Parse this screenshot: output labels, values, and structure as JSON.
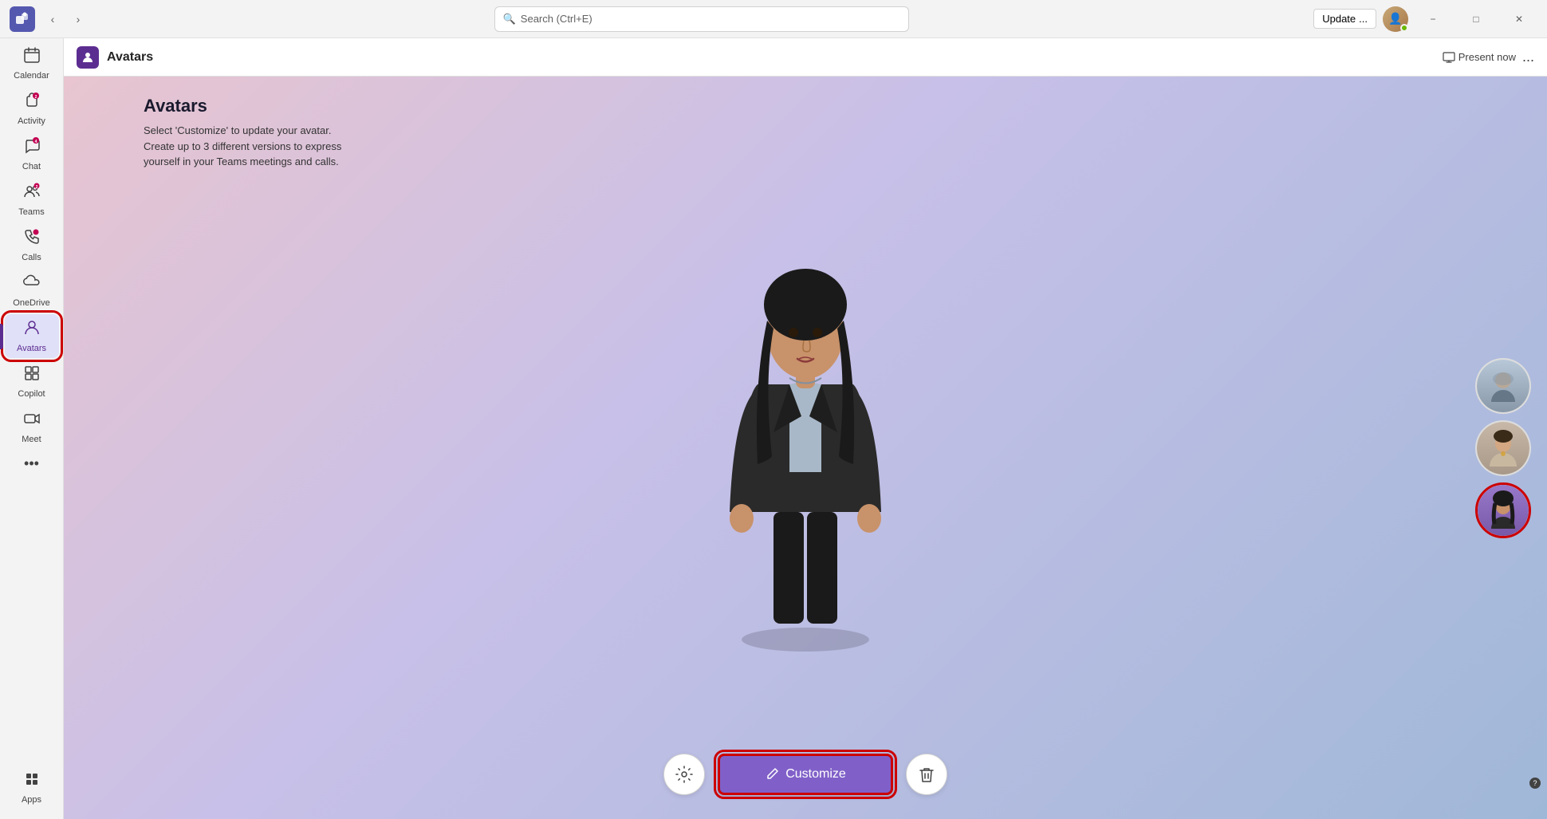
{
  "titleBar": {
    "searchPlaceholder": "Search (Ctrl+E)",
    "updateLabel": "Update",
    "moreLabel": "...",
    "minimizeLabel": "−",
    "maximizeLabel": "□",
    "closeLabel": "✕"
  },
  "sidebar": {
    "items": [
      {
        "id": "calendar",
        "label": "Calendar",
        "icon": "📅",
        "badge": null
      },
      {
        "id": "activity",
        "label": "Activity",
        "icon": "🔔",
        "badge": "2"
      },
      {
        "id": "chat",
        "label": "Chat",
        "icon": "💬",
        "badge": "4"
      },
      {
        "id": "teams",
        "label": "Teams",
        "icon": "👥",
        "badge": "2"
      },
      {
        "id": "calls",
        "label": "Calls",
        "icon": "📞",
        "badge": "dot"
      },
      {
        "id": "onedrive",
        "label": "OneDrive",
        "icon": "☁",
        "badge": null
      },
      {
        "id": "avatars",
        "label": "Avatars",
        "icon": "👤",
        "badge": null,
        "active": true
      },
      {
        "id": "copilot",
        "label": "Copilot",
        "icon": "⧉",
        "badge": null
      },
      {
        "id": "meet",
        "label": "Meet",
        "icon": "🎥",
        "badge": null
      }
    ],
    "more": "•••",
    "apps": {
      "label": "Apps",
      "icon": "+"
    }
  },
  "appBar": {
    "title": "Avatars",
    "presentLabel": "Present now",
    "moreLabel": "..."
  },
  "page": {
    "title": "Avatars",
    "description1": "Select 'Customize' to update your avatar.",
    "description2": "Create up to 3 different versions to express",
    "description3": "yourself in your Teams meetings and calls."
  },
  "controls": {
    "settingsIcon": "⚙",
    "customizeLabel": "Customize",
    "pencilIcon": "✏",
    "deleteIcon": "🗑"
  },
  "avatarThumbs": [
    {
      "id": "thumb-male",
      "selected": false,
      "label": "Male avatar"
    },
    {
      "id": "thumb-female2",
      "selected": false,
      "label": "Female avatar 2"
    },
    {
      "id": "thumb-female1",
      "selected": true,
      "label": "Female avatar 1"
    }
  ]
}
